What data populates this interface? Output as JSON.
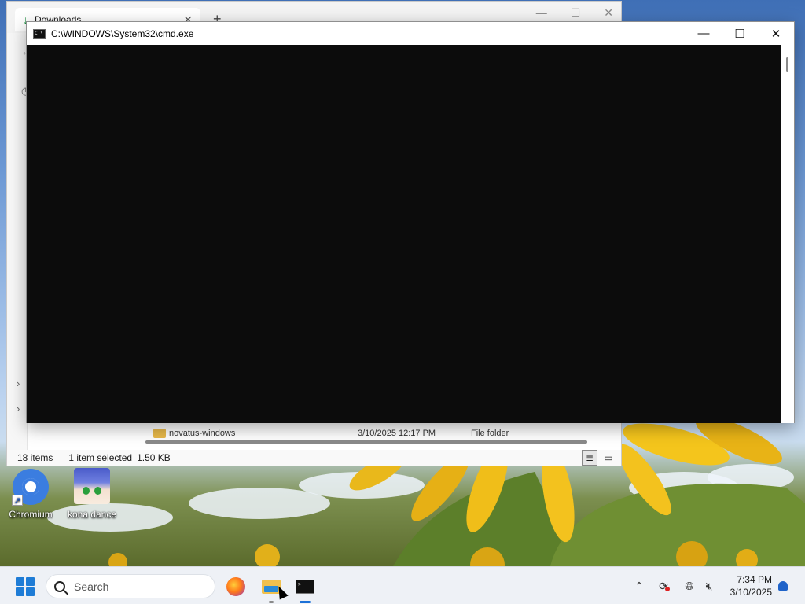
{
  "explorer": {
    "tab_title": "Downloads",
    "status": {
      "items": "18 items",
      "selected": "1 item selected",
      "size": "1.50 KB"
    },
    "file_row": {
      "name": "novatus-windows",
      "date": "3/10/2025 12:17 PM",
      "type": "File folder"
    }
  },
  "cmd": {
    "title": "C:\\WINDOWS\\System32\\cmd.exe"
  },
  "desktop": {
    "icons": [
      {
        "label": "Chromium"
      },
      {
        "label": "kona dance"
      }
    ]
  },
  "taskbar": {
    "search_placeholder": "Search",
    "clock_time": "7:34 PM",
    "clock_date": "3/10/2025"
  }
}
